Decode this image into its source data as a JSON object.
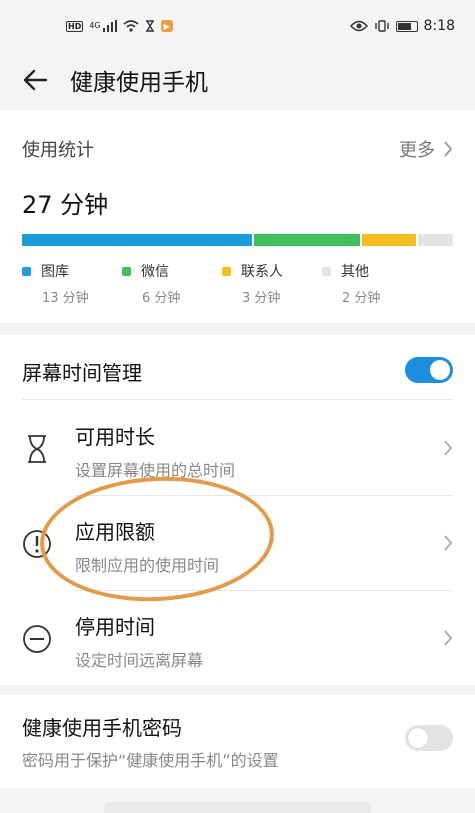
{
  "status_bar": {
    "hd": "HD",
    "network": "4G",
    "time": "8:18"
  },
  "header": {
    "title": "健康使用手机"
  },
  "usage": {
    "label": "使用统计",
    "more": "更多",
    "total": "27 分钟",
    "categories": [
      {
        "name": "图库",
        "value": "13 分钟",
        "minutes": 13,
        "color": "#189fe0"
      },
      {
        "name": "微信",
        "value": "6 分钟",
        "minutes": 6,
        "color": "#3ec25a"
      },
      {
        "name": "联系人",
        "value": "3 分钟",
        "minutes": 3,
        "color": "#f3bd1c"
      },
      {
        "name": "其他",
        "value": "2 分钟",
        "minutes": 2,
        "color": "#e3e3e3"
      }
    ]
  },
  "screen_time": {
    "label": "屏幕时间管理",
    "enabled": true,
    "items": [
      {
        "icon": "hourglass-icon",
        "name": "可用时长",
        "desc": "设置屏幕使用的总时间"
      },
      {
        "icon": "alert-circle-icon",
        "name": "应用限额",
        "desc": "限制应用的使用时间"
      },
      {
        "icon": "minus-circle-icon",
        "name": "停用时间",
        "desc": "设定时间远离屏幕"
      }
    ]
  },
  "password": {
    "title": "健康使用手机密码",
    "desc": "密码用于保护“健康使用手机”的设置",
    "enabled": false
  },
  "colors": {
    "accent": "#1a8fe0",
    "annotation": "#e59a47"
  }
}
